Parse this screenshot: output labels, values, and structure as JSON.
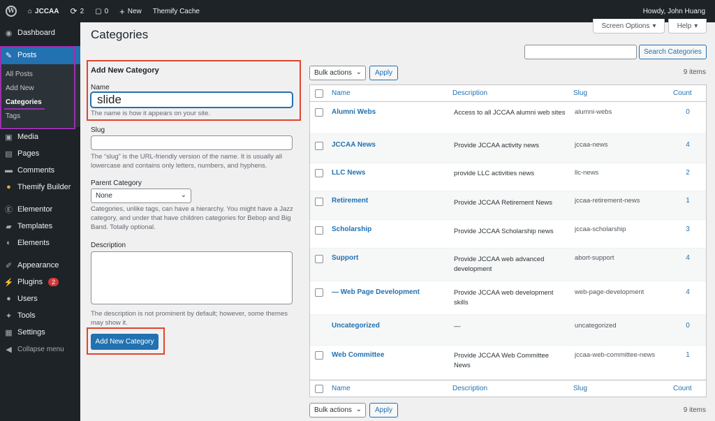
{
  "adminbar": {
    "site_name": "JCCAA",
    "updates_count": "2",
    "comments_count": "0",
    "new_label": "New",
    "themify_label": "Themify Cache",
    "howdy": "Howdy, John Huang"
  },
  "sidebar": {
    "items": [
      {
        "label": "Dashboard",
        "icon": "dashboard-icon"
      },
      {
        "label": "Posts",
        "icon": "pin-icon"
      },
      {
        "label": "Media",
        "icon": "media-icon"
      },
      {
        "label": "Pages",
        "icon": "pages-icon"
      },
      {
        "label": "Comments",
        "icon": "comments-icon"
      },
      {
        "label": "Themify Builder",
        "icon": "themify-icon"
      },
      {
        "label": "Elementor",
        "icon": "elementor-icon"
      },
      {
        "label": "Templates",
        "icon": "folder-icon"
      },
      {
        "label": "Elements",
        "icon": "elements-icon"
      },
      {
        "label": "Appearance",
        "icon": "brush-icon"
      },
      {
        "label": "Plugins",
        "icon": "plugin-icon",
        "badge": "2"
      },
      {
        "label": "Users",
        "icon": "users-icon"
      },
      {
        "label": "Tools",
        "icon": "wrench-icon"
      },
      {
        "label": "Settings",
        "icon": "settings-icon"
      }
    ],
    "submenu": [
      "All Posts",
      "Add New",
      "Categories",
      "Tags"
    ],
    "collapse_label": "Collapse menu"
  },
  "header": {
    "title": "Categories",
    "screen_options": "Screen Options",
    "help": "Help"
  },
  "form": {
    "title": "Add New Category",
    "name_label": "Name",
    "name_value": "slide",
    "name_hint": "The name is how it appears on your site.",
    "slug_label": "Slug",
    "slug_hint": "The “slug” is the URL-friendly version of the name. It is usually all lowercase and contains only letters, numbers, and hyphens.",
    "parent_label": "Parent Category",
    "parent_value": "None",
    "parent_hint": "Categories, unlike tags, can have a hierarchy. You might have a Jazz category, and under that have children categories for Bebop and Big Band. Totally optional.",
    "description_label": "Description",
    "description_hint": "The description is not prominent by default; however, some themes may show it.",
    "submit": "Add New Category"
  },
  "search": {
    "button": "Search Categories"
  },
  "bulk": {
    "label": "Bulk actions",
    "apply": "Apply",
    "items_count": "9 items"
  },
  "table": {
    "headers": {
      "name": "Name",
      "description": "Description",
      "slug": "Slug",
      "count": "Count"
    },
    "rows": [
      {
        "name": "Alumni Webs",
        "description": "Access to all JCCAA alumni web sites",
        "slug": "alumni-webs",
        "count": "0"
      },
      {
        "name": "JCCAA News",
        "description": "Provide JCCAA activity news",
        "slug": "jccaa-news",
        "count": "4"
      },
      {
        "name": "LLC News",
        "description": "provide LLC activities news",
        "slug": "llc-news",
        "count": "2"
      },
      {
        "name": "Retirement",
        "description": "Provide JCCAA Retirement News",
        "slug": "jccaa-retirement-news",
        "count": "1"
      },
      {
        "name": "Scholarship",
        "description": "Provide JCCAA Scholarship news",
        "slug": "jccaa-scholarship",
        "count": "3"
      },
      {
        "name": "Support",
        "description": "Provide JCCAA web advanced development",
        "slug": "abort-support",
        "count": "4"
      },
      {
        "name": "— Web Page Development",
        "description": "Provide JCCAA web development skills",
        "slug": "web-page-development",
        "count": "4"
      },
      {
        "name": "Uncategorized",
        "description": "—",
        "slug": "uncategorized",
        "count": "0"
      },
      {
        "name": "Web Committee",
        "description": "Provide JCCAA Web Committee News",
        "slug": "jccaa-web-committee-news",
        "count": "1"
      }
    ]
  },
  "colors": {
    "accent": "#2271b1",
    "sidebar_bg": "#1d2327",
    "highlight_red": "#e0442c",
    "highlight_purple": "#9b2fae"
  }
}
